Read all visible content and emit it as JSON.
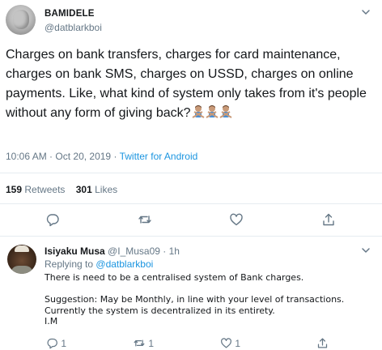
{
  "tweet": {
    "display_name": "BAMIDELE",
    "handle": "@datblarkboi",
    "text": "Charges on bank transfers, charges for card maintenance, charges on bank SMS, charges on USSD, charges on online payments. Like, what kind of system only takes from it's people without any form of giving back?",
    "emoji_names": [
      "man-gesturing-no-emoji",
      "man-gesturing-no-emoji",
      "man-gesturing-no-emoji"
    ],
    "time": "10:06 AM",
    "date": "Oct 20, 2019",
    "separator": "·",
    "source": "Twitter for Android",
    "retweets_count": "159",
    "retweets_label": "Retweets",
    "likes_count": "301",
    "likes_label": "Likes",
    "action_icons": [
      "reply-icon",
      "retweet-icon",
      "like-icon",
      "share-icon"
    ]
  },
  "reply": {
    "display_name": "Isiyaku Musa",
    "handle": "@I_Musa09",
    "separator": "·",
    "age": "1h",
    "replying_label": "Replying to",
    "replying_to": "@datblarkboi",
    "lines": [
      "There is need to be a centralised system of Bank charges.",
      "",
      "Suggestion: May be Monthly, in line with your level of transactions.",
      "Currently the system is decentralized in its entirety.",
      "I.M"
    ],
    "reply_count": "1",
    "retweet_count": "1",
    "like_count": "1"
  },
  "colors": {
    "link": "#1b95e0",
    "muted": "#657786",
    "text": "#14171a",
    "divider": "#e6ecf0"
  }
}
